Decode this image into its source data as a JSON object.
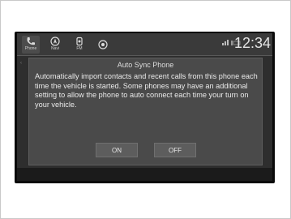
{
  "statusbar": {
    "nav": [
      {
        "label": "Phone",
        "icon": "phone-icon"
      },
      {
        "label": "Navi",
        "icon": "navigation-icon"
      },
      {
        "label": "FM",
        "icon": "radio-icon"
      },
      {
        "label": "",
        "icon": "camera-icon"
      }
    ],
    "clock": "12:34"
  },
  "dialog": {
    "title": "Auto Sync Phone",
    "body": "Automatically import contacts and recent calls from this phone each time the vehicle is started. Some phones may have an additional setting to allow the phone to auto connect each time your turn on your vehicle.",
    "on_label": "ON",
    "off_label": "OFF"
  },
  "colors": {
    "screen_bg": "#2e2e2e",
    "dialog_bg": "#4a4a4a",
    "text": "#eaeaea"
  }
}
